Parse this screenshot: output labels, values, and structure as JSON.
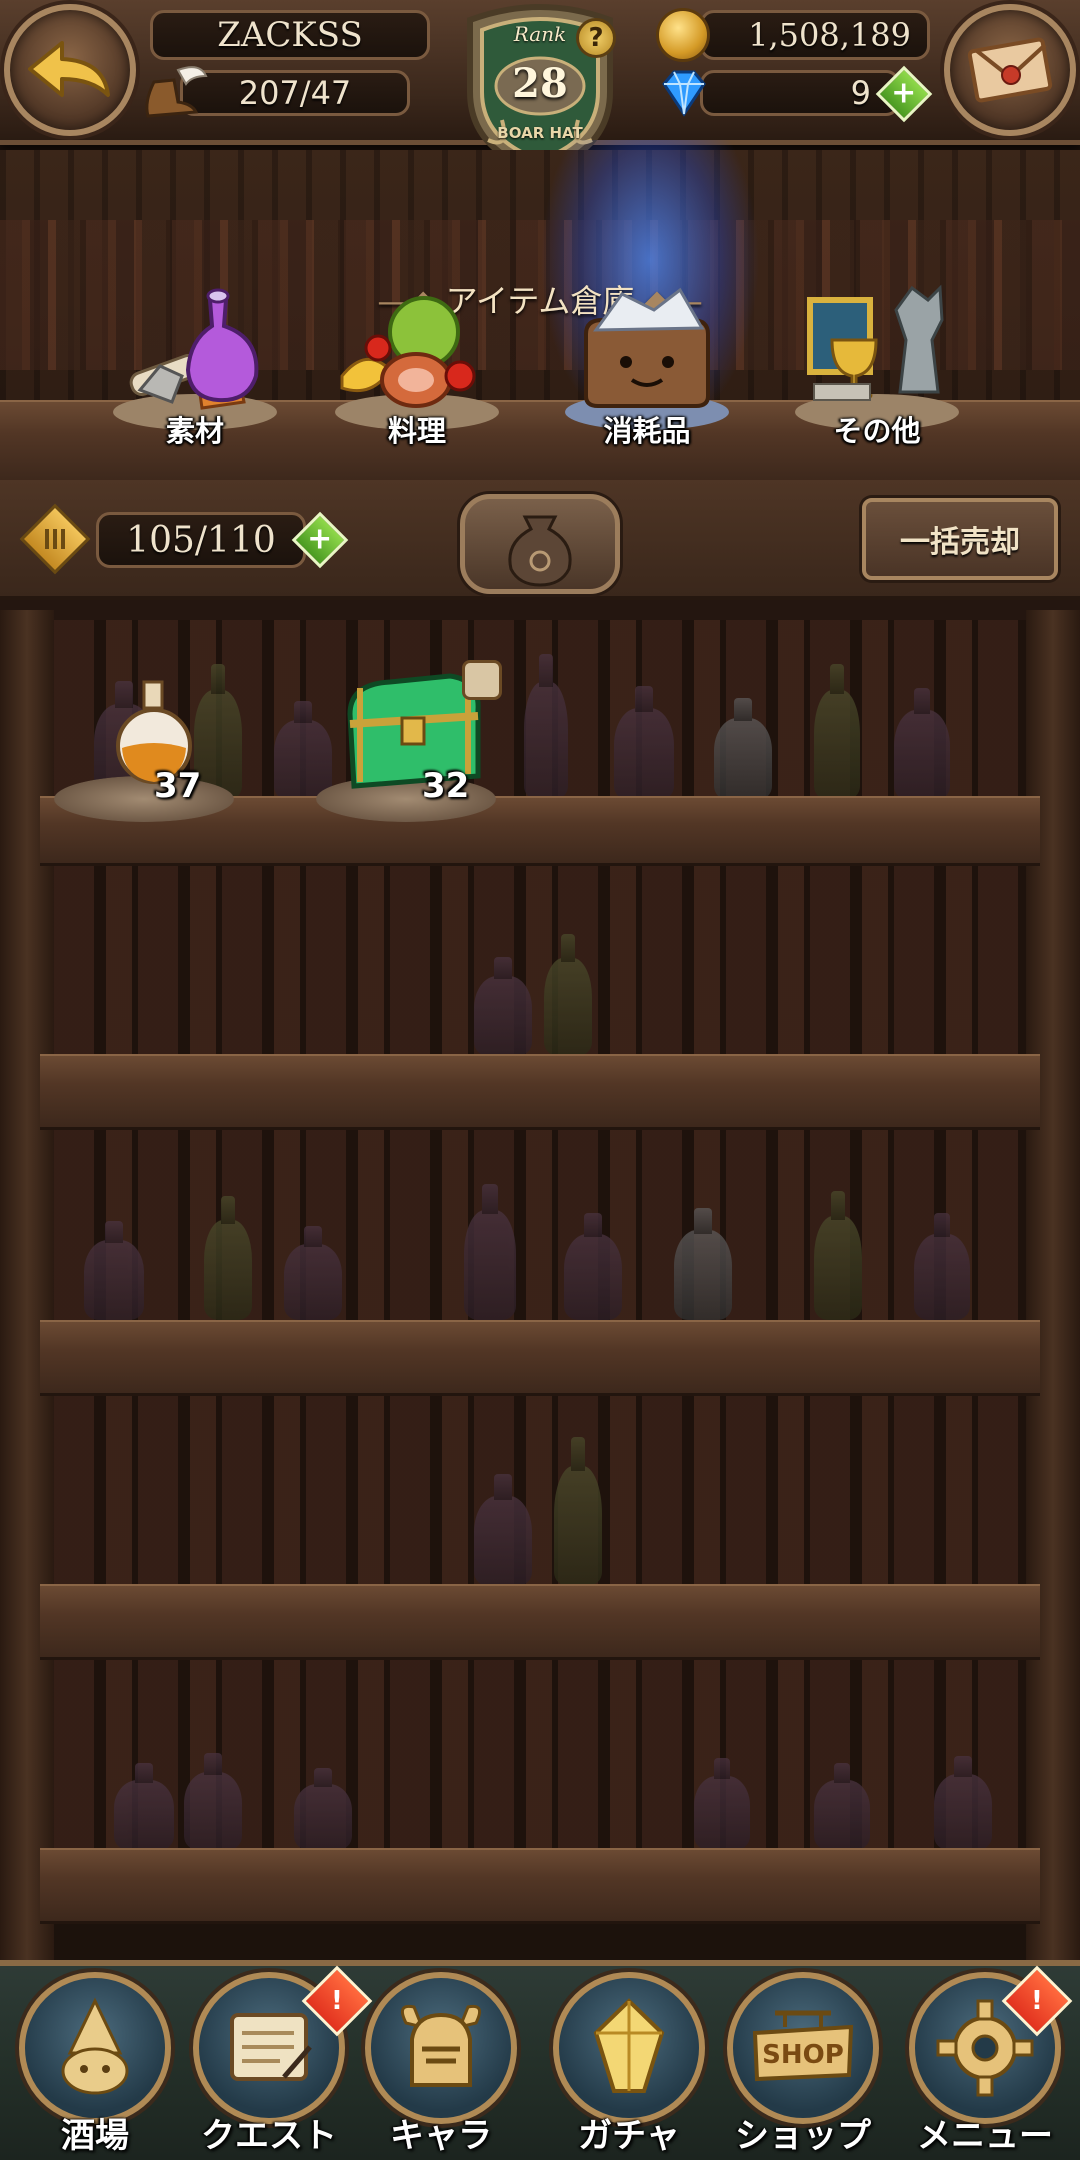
{
  "header": {
    "player_name": "ZACKSS",
    "stamina": "207/47",
    "rank_label": "Rank",
    "rank_value": "28",
    "rank_emblem_text": "BOAR HAT",
    "help_icon": "?",
    "coins": "1,508,189",
    "gems": "9"
  },
  "storage": {
    "title": "アイテム倉庫",
    "categories": [
      {
        "label": "素材",
        "icon": "materials-icon"
      },
      {
        "label": "料理",
        "icon": "food-icon"
      },
      {
        "label": "消耗品",
        "icon": "consumables-icon",
        "selected": true
      },
      {
        "label": "その他",
        "icon": "other-icon"
      }
    ],
    "capacity": "105/110",
    "bulk_sell_label": "一括売却"
  },
  "items": [
    {
      "icon": "potion-icon",
      "quantity": "37"
    },
    {
      "icon": "green-chest-icon",
      "quantity": "32"
    }
  ],
  "nav": [
    {
      "label": "酒場",
      "icon": "tavern-icon",
      "alert": false
    },
    {
      "label": "クエスト",
      "icon": "quest-scroll-icon",
      "alert": true
    },
    {
      "label": "キャラ",
      "icon": "character-helmet-icon",
      "alert": false
    },
    {
      "label": "ガチャ",
      "icon": "gacha-crystal-icon",
      "alert": false
    },
    {
      "label": "ショップ",
      "icon": "shop-sign-icon",
      "alert": false,
      "sign_text": "SHOP"
    },
    {
      "label": "メニュー",
      "icon": "menu-gear-icon",
      "alert": true
    }
  ],
  "alert_mark": "!",
  "colors": {
    "accent_gold": "#d9b26a",
    "selected_glow": "#3a7bff",
    "nav_bg": "#243029"
  }
}
